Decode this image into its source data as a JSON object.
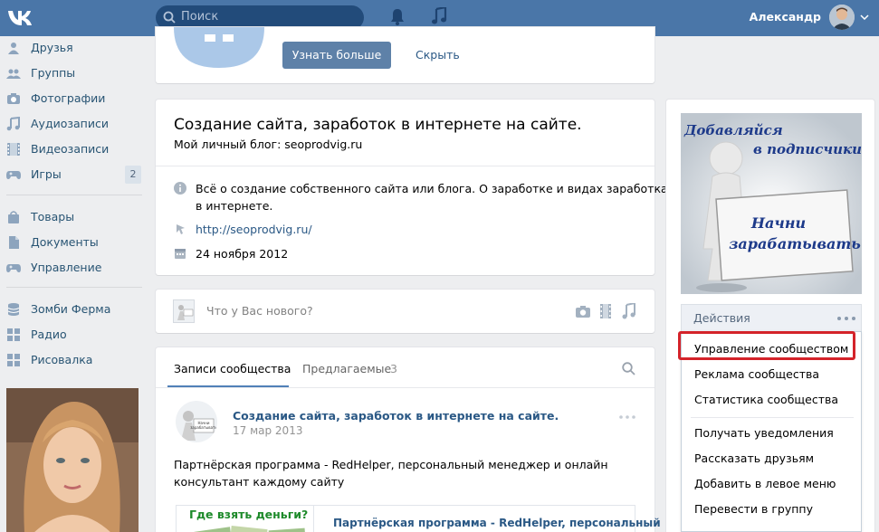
{
  "header": {
    "search_placeholder": "Поиск",
    "username": "Александр"
  },
  "sidebar": {
    "items": [
      {
        "label": "Друзья"
      },
      {
        "label": "Группы"
      },
      {
        "label": "Фотографии"
      },
      {
        "label": "Аудиозаписи"
      },
      {
        "label": "Видеозаписи"
      },
      {
        "label": "Игры",
        "count": "2"
      },
      {
        "label": "Товары"
      },
      {
        "label": "Документы"
      },
      {
        "label": "Управление"
      },
      {
        "label": "Зомби Ферма"
      },
      {
        "label": "Радио"
      },
      {
        "label": "Рисовалка"
      }
    ]
  },
  "promo": {
    "learn_more": "Узнать больше",
    "hide": "Скрыть"
  },
  "group_info": {
    "title": "Создание сайта, заработок в интернете на сайте.",
    "status": "Мой личный блог: seoprodvig.ru",
    "description_line1": "Всё о создание собственного сайта или блога. О заработке и видах заработка",
    "description_line2": "в интернете.",
    "website": "http://seoprodvig.ru/",
    "date": "24 ноября 2012"
  },
  "composer": {
    "placeholder": "Что у Вас нового?"
  },
  "wall": {
    "tab_posts": "Записи сообщества",
    "tab_suggested": "Предлагаемые",
    "tab_suggested_count": "3",
    "post": {
      "author": "Создание сайта, заработок в интернете на сайте.",
      "date": "17 мар 2013",
      "text_line1": "Партнёрская программа - RedHelper, персональный менеджер и онлайн",
      "text_line2": "консультант каждому сайту",
      "attachment_caption": "Где взять деньги?",
      "attachment_title": "Партнёрская программа - RedHelper, персональный"
    }
  },
  "cover": {
    "line1": "Добавляйся",
    "line2": "в подписчики!",
    "sign_line1": "Начни",
    "sign_line2": "зарабатывать"
  },
  "actions": {
    "header": "Действия",
    "items": [
      "Управление сообществом",
      "Реклама сообщества",
      "Статистика сообщества",
      "Получать уведомления",
      "Рассказать друзьям",
      "Добавить в левое меню",
      "Перевести в группу"
    ]
  },
  "colors": {
    "header_bg": "#4a76a8",
    "link": "#2a5885",
    "highlight": "#d4232a"
  }
}
